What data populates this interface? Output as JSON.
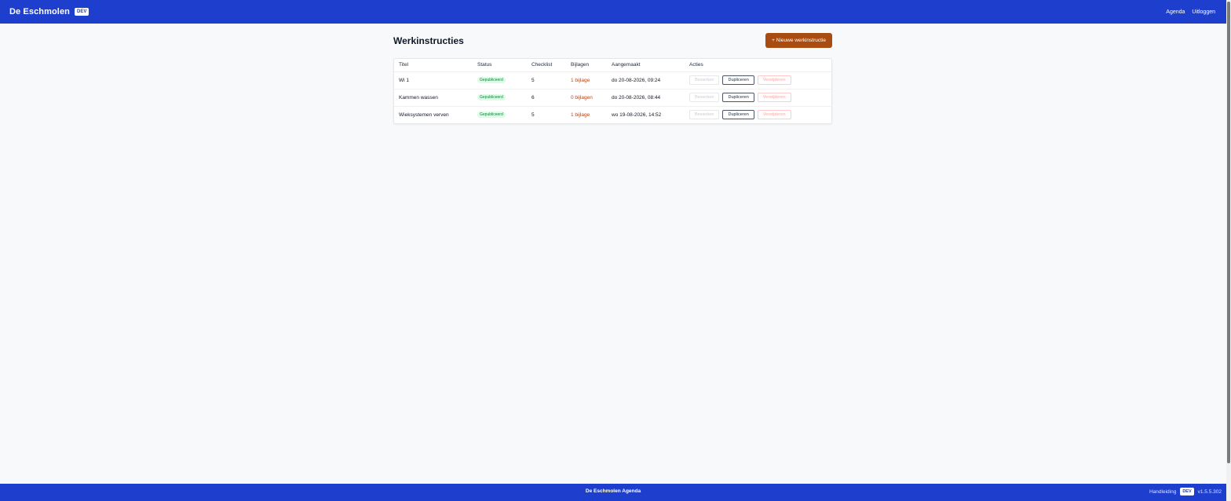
{
  "header": {
    "brand": "De Eschmolen",
    "env_badge": "DEV",
    "nav": {
      "agenda": "Agenda",
      "logout": "Uitloggen"
    }
  },
  "page": {
    "title": "Werkinstructies",
    "new_button": "+ Nieuwe werkinstructie"
  },
  "table": {
    "columns": {
      "title": "Titel",
      "status": "Status",
      "checklist": "Checklist",
      "attachments": "Bijlagen",
      "created": "Aangemaakt",
      "actions": "Acties"
    },
    "rows": [
      {
        "title": "Wi 1",
        "status": "Gepubliceerd",
        "checklist": "5",
        "attachments": "1 bijlage",
        "created": "do 20-08-2026, 09:24"
      },
      {
        "title": "Kammen wassen",
        "status": "Gepubliceerd",
        "checklist": "6",
        "attachments": "0 bijlagen",
        "created": "do 20-08-2026, 08:44"
      },
      {
        "title": "Wieksystemen verven",
        "status": "Gepubliceerd",
        "checklist": "5",
        "attachments": "1 bijlage",
        "created": "wo 19-08-2026, 14:52"
      }
    ],
    "actions": {
      "edit": "Bewerken",
      "duplicate": "Dupliceren",
      "delete": "Verwijderen"
    }
  },
  "footer": {
    "center": "De Eschmolen Agenda",
    "manual": "Handleiding",
    "env_badge": "DEV",
    "version": "v1.5.5.302"
  },
  "colors": {
    "primary": "#1e3fce",
    "accent_button": "#a84c11",
    "status_published": "#15803d",
    "attachment_link": "#c2410c"
  }
}
